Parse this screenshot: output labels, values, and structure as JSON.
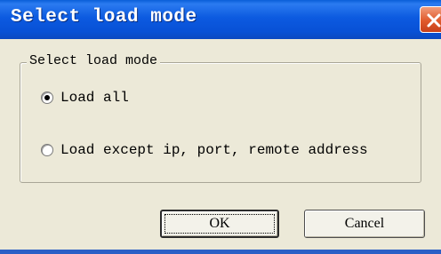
{
  "window": {
    "title": "Select load mode"
  },
  "group": {
    "label": "Select load mode",
    "options": [
      {
        "label": "Load all",
        "selected": true
      },
      {
        "label": "Load except ip, port, remote address",
        "selected": false
      }
    ]
  },
  "buttons": {
    "ok": "OK",
    "cancel": "Cancel"
  },
  "icons": {
    "close": "close-icon"
  },
  "colors": {
    "titlebar": "#0c5ae0",
    "close": "#e05a2c",
    "dialog_bg": "#ece9d8"
  }
}
